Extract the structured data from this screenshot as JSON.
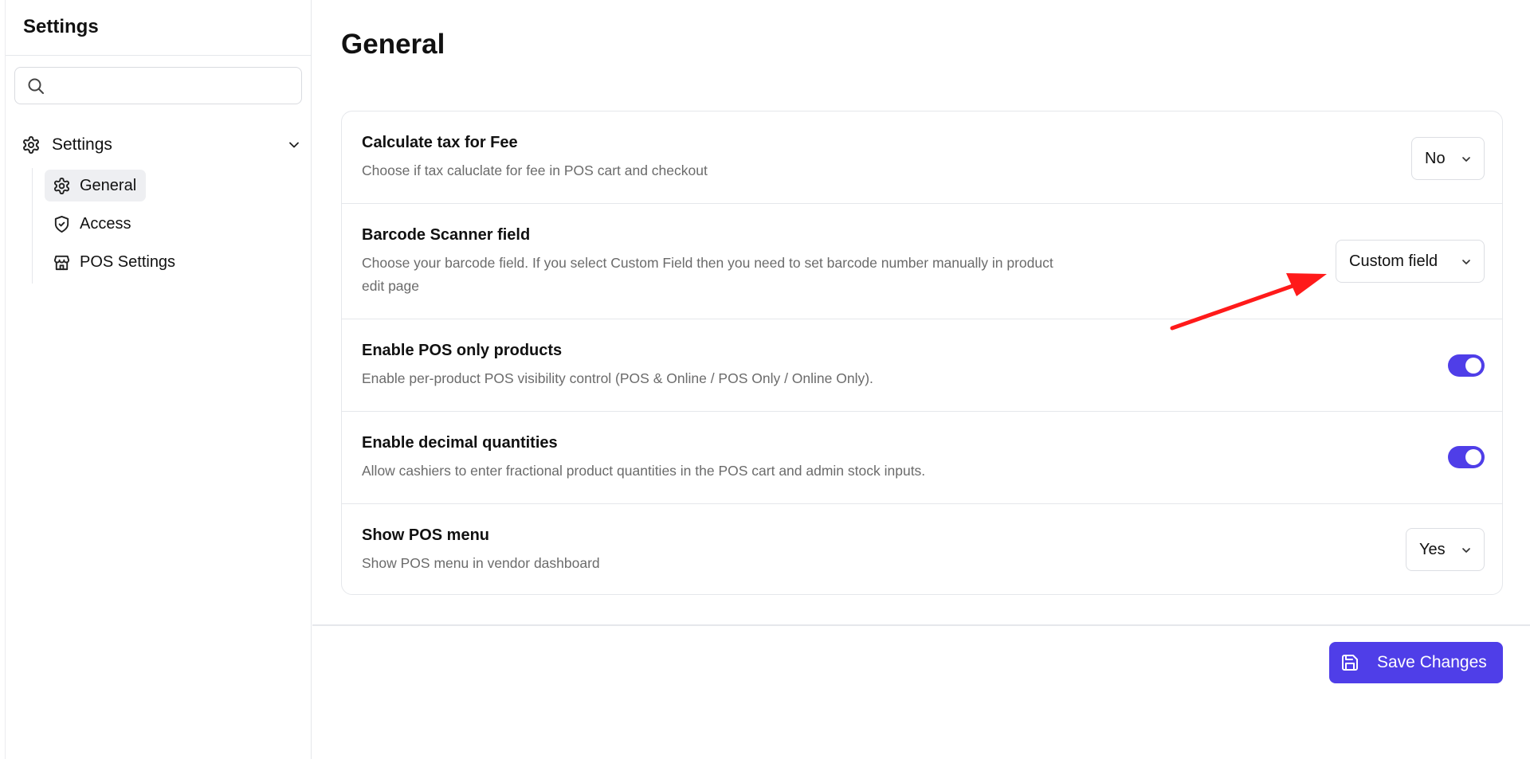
{
  "sidebar": {
    "title": "Settings",
    "search": {
      "placeholder": "",
      "value": ""
    },
    "group": {
      "label": "Settings",
      "expanded": true
    },
    "items": [
      {
        "label": "General",
        "icon": "gear-icon",
        "active": true
      },
      {
        "label": "Access",
        "icon": "shield-check-icon",
        "active": false
      },
      {
        "label": "POS Settings",
        "icon": "store-icon",
        "active": false
      }
    ]
  },
  "main": {
    "title": "General",
    "settings": [
      {
        "title": "Calculate tax for Fee",
        "description": "Choose if tax caluclate for fee in POS cart and checkout",
        "control": "select",
        "value": "No"
      },
      {
        "title": "Barcode Scanner field",
        "description": "Choose your barcode field. If you select Custom Field then you need to set barcode number manually in product edit page",
        "control": "select",
        "value": "Custom field"
      },
      {
        "title": "Enable POS only products",
        "description": "Enable per-product POS visibility control (POS & Online / POS Only / Online Only).",
        "control": "toggle",
        "checked": true
      },
      {
        "title": "Enable decimal quantities",
        "description": "Allow cashiers to enter fractional product quantities in the POS cart and admin stock inputs.",
        "control": "toggle",
        "checked": true
      },
      {
        "title": "Show POS menu",
        "description": "Show POS menu in vendor dashboard",
        "control": "select",
        "value": "Yes"
      }
    ],
    "save_label": "Save Changes"
  },
  "colors": {
    "accent": "#4f3ee8",
    "annotation": "#ff1a1a",
    "border": "#e5e7eb",
    "muted_text": "#6b6b6b"
  }
}
